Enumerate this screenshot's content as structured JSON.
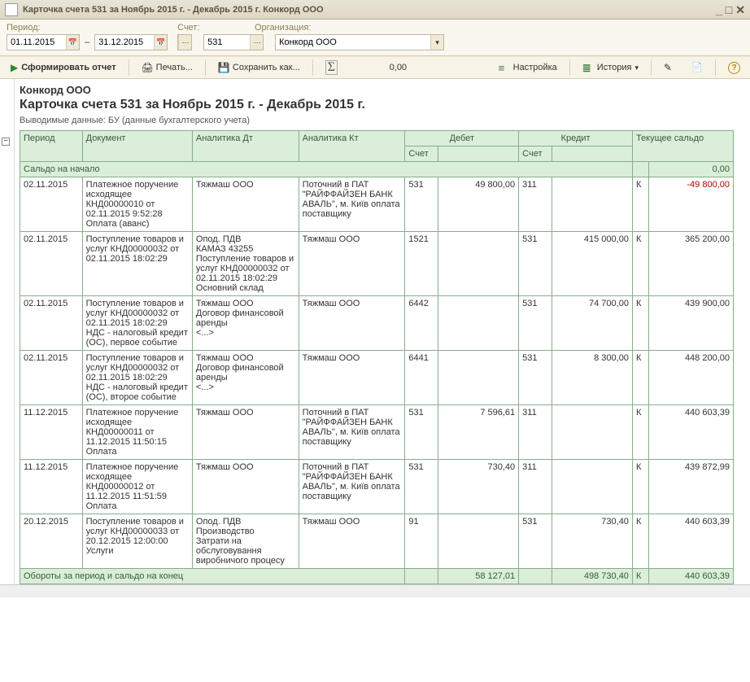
{
  "window": {
    "title": "Карточка счета 531 за Ноябрь 2015 г. - Декабрь 2015 г. Конкорд ООО"
  },
  "params": {
    "period_label": "Период:",
    "account_label": "Счет:",
    "org_label": "Организация:",
    "date_from": "01.11.2015",
    "date_to": "31.12.2015",
    "account": "531",
    "org": "Конкорд ООО"
  },
  "toolbar": {
    "form_report": "Сформировать отчет",
    "print": "Печать...",
    "save_as": "Сохранить как...",
    "sigma_value": "0,00",
    "settings": "Настройка",
    "history": "История"
  },
  "report": {
    "org": "Конкорд ООО",
    "title": "Карточка счета 531 за Ноябрь 2015 г. - Декабрь 2015 г.",
    "subtitle": "Выводимые данные:  БУ (данные бухгалтерского учета)",
    "cols": {
      "period": "Период",
      "document": "Документ",
      "analytic_dt": "Аналитика Дт",
      "analytic_kt": "Аналитика Кт",
      "debit": "Дебет",
      "credit": "Кредит",
      "balance": "Текущее сальдо",
      "account_sub": "Счет"
    },
    "opening_row_label": "Сальдо на начало",
    "opening_balance": "0,00",
    "rows": [
      {
        "period": "02.11.2015",
        "document": "Платежное поручение исходящее КНД00000010 от 02.11.2015 9:52:28\nОплата (аванс)",
        "adt": "Тяжмаш ООО",
        "akt": "Поточний в ПАТ \"РАЙФФАЙЗЕН БАНК АВАЛЬ\", м. Київ оплата поставщику",
        "dacct": "531",
        "damt": "49 800,00",
        "cacct": "311",
        "camt": "",
        "bflag": "К",
        "balance": "-49 800,00",
        "neg": true
      },
      {
        "period": "02.11.2015",
        "document": "Поступление товаров и услуг КНД00000032 от 02.11.2015 18:02:29",
        "adt": "Опод. ПДВ\nКАМАЗ 43255\nПоступление товаров и услуг КНД00000032 от 02.11.2015 18:02:29\nОсновний склад",
        "akt": "Тяжмаш ООО",
        "dacct": "1521",
        "damt": "",
        "cacct": "531",
        "camt": "415 000,00",
        "bflag": "К",
        "balance": "365 200,00"
      },
      {
        "period": "02.11.2015",
        "document": "Поступление товаров и услуг КНД00000032 от 02.11.2015 18:02:29\nНДС - налоговый кредит (ОС), первое событие",
        "adt": "Тяжмаш ООО\nДоговор финансовой аренды\n<...>",
        "akt": "Тяжмаш ООО",
        "dacct": "6442",
        "damt": "",
        "cacct": "531",
        "camt": "74 700,00",
        "bflag": "К",
        "balance": "439 900,00"
      },
      {
        "period": "02.11.2015",
        "document": "Поступление товаров и услуг КНД00000032 от 02.11.2015 18:02:29\nНДС - налоговый кредит (ОС), второе событие",
        "adt": "Тяжмаш ООО\nДоговор финансовой аренды\n<...>",
        "akt": "Тяжмаш ООО",
        "dacct": "6441",
        "damt": "",
        "cacct": "531",
        "camt": "8 300,00",
        "bflag": "К",
        "balance": "448 200,00"
      },
      {
        "period": "11.12.2015",
        "document": "Платежное поручение исходящее КНД00000011 от 11.12.2015 11:50:15\nОплата",
        "adt": "Тяжмаш ООО",
        "akt": "Поточний в ПАТ \"РАЙФФАЙЗЕН БАНК АВАЛЬ\", м. Київ оплата поставщику",
        "dacct": "531",
        "damt": "7 596,61",
        "cacct": "311",
        "camt": "",
        "bflag": "К",
        "balance": "440 603,39"
      },
      {
        "period": "11.12.2015",
        "document": "Платежное поручение исходящее КНД00000012 от 11.12.2015 11:51:59\nОплата",
        "adt": "Тяжмаш ООО",
        "akt": "Поточний в ПАТ \"РАЙФФАЙЗЕН БАНК АВАЛЬ\", м. Київ оплата поставщику",
        "dacct": "531",
        "damt": "730,40",
        "cacct": "311",
        "camt": "",
        "bflag": "К",
        "balance": "439 872,99"
      },
      {
        "period": "20.12.2015",
        "document": "Поступление товаров и услуг КНД00000033 от 20.12.2015 12:00:00\nУслуги",
        "adt": "Опод. ПДВ\nПроизводство\nЗатрати на обслуговування виробничого процесу",
        "akt": "Тяжмаш ООО",
        "dacct": "91",
        "damt": "",
        "cacct": "531",
        "camt": "730,40",
        "bflag": "К",
        "balance": "440 603,39"
      }
    ],
    "totals_label": "Обороты за период и сальдо на конец",
    "totals_debit": "58 127,01",
    "totals_credit": "498 730,40",
    "totals_bflag": "К",
    "totals_balance": "440 603,39"
  }
}
